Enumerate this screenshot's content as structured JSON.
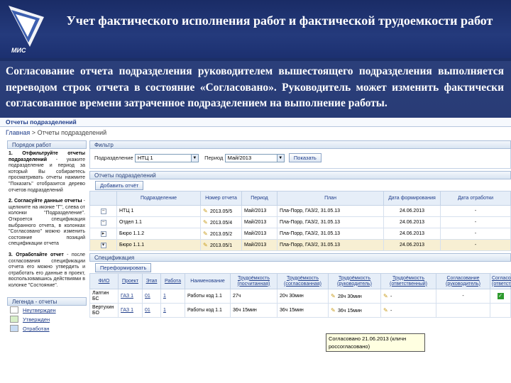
{
  "slide": {
    "logo_text": "МИС",
    "title": "Учет фактического исполнения работ и фактической трудоемкости работ",
    "body": "Согласование отчета подразделения руководителем вышестоящего подразделения выполняется переводом строк отчета в состояние «Согласовано». Руководитель может изменить фактически согласованное времени затраченное подразделением на выполнение работы."
  },
  "app": {
    "window_title": "Отчеты подразделений",
    "breadcrumb_home": "Главная",
    "breadcrumb_sep": ">",
    "breadcrumb_current": "Отчеты подразделений",
    "left_panel_title": "Порядок работ",
    "steps": [
      {
        "head": "1. Отфильтруйте отчеты подразделений",
        "text": "- укажите подразделение и период за который Вы собираетесь просматривать отчеты нажмите \"Показать\" отобразится дерево отчетов подразделений"
      },
      {
        "head": "2. Согласуйте данные отчеты",
        "text": "- щелкните на иконке \"Г\", слева от колонки \"Подразделение\". Откроется спецификация выбранного отчета, в колонках \"Согласовано\" можно изменить состояние позиций спецификации отчета"
      },
      {
        "head": "3. Отработайте отчет",
        "text": "- после согласования спецификации отчета его можно утвердить и отработать его данные в проект, воспользовавшись действиями в колонке \"Состояние\"."
      }
    ],
    "legend_title": "Легенда - отчеты",
    "legend": [
      {
        "label": "Неутвержден",
        "color": "#ffffff"
      },
      {
        "label": "Утвержден",
        "color": "#d8efc8"
      },
      {
        "label": "Отработан",
        "color": "#c8dcf4"
      }
    ],
    "filter": {
      "title": "Фильтр",
      "dept_label": "Подразделение",
      "dept_value": "НТЦ 1",
      "period_label": "Период",
      "period_value": "Май/2013",
      "show_button": "Показать"
    },
    "reports": {
      "title": "Отчеты подразделений",
      "add_button": "Добавить отчёт",
      "columns": [
        "",
        "Подразделение",
        "Номер отчета",
        "Период",
        "План",
        "Дата формирования",
        "Дата отработки"
      ],
      "rows": [
        {
          "tree": "−",
          "dept": "НТЦ 1",
          "number": "2013.05/5",
          "period": "Май/2013",
          "plan": "Пла-Порр, ГАЗ/2, 31.05.13",
          "created": "24.06.2013",
          "processed": "-"
        },
        {
          "tree": "−",
          "dept": "Отдел 1.1",
          "number": "2013.05/4",
          "period": "Май/2013",
          "plan": "Пла-Порр, ГАЗ/2, 31.05.13",
          "created": "24.06.2013",
          "processed": "-"
        },
        {
          "tree": "▸",
          "dept": "Бюро 1.1.2",
          "number": "2013.05/2",
          "period": "Май/2013",
          "plan": "Пла-Порр, ГАЗ/2, 31.05.13",
          "created": "24.06.2013",
          "processed": "-"
        },
        {
          "tree": "▾",
          "dept": "Бюро 1.1.1",
          "number": "2013.05/1",
          "period": "Май/2013",
          "plan": "Пла-Порр, ГАЗ/2, 31.05.13",
          "created": "24.06.2013",
          "processed": "-"
        }
      ]
    },
    "spec": {
      "title": "Спецификация",
      "reform_button": "Переформировать",
      "columns": [
        "ФИО",
        "Проект",
        "Этап",
        "Работа",
        "Наименование",
        "Трудоёмкость (посчитанная)",
        "Трудоёмкость (согласованная)",
        "Трудоёмкость (руководитель)",
        "Трудоёмкость (ответственный)",
        "Согласование (руководитель)",
        "Согласование (ответственный)"
      ],
      "rows": [
        {
          "fio": "Лаптин БС",
          "project": "ГАЗ 1",
          "stage": "01",
          "work": "1",
          "name": "Работы код 1.1",
          "calc": "27ч",
          "agreed": "20ч 30мин",
          "manager": "28ч 30мин",
          "resp": "-",
          "mgr_state": "-",
          "resp_state": ""
        },
        {
          "fio": "Вертухин БО",
          "project": "ГАЗ 1",
          "stage": "01",
          "work": "1",
          "name": "Работы код 1.1",
          "calc": "36ч 15мин",
          "agreed": "36ч 15мин",
          "manager": "36ч 15мин",
          "resp": "-",
          "mgr_state": "",
          "resp_state": ""
        }
      ],
      "tooltip_line1": "Согласовано 21.06.2013 (кличн",
      "tooltip_line2": "россогласовано)"
    }
  }
}
